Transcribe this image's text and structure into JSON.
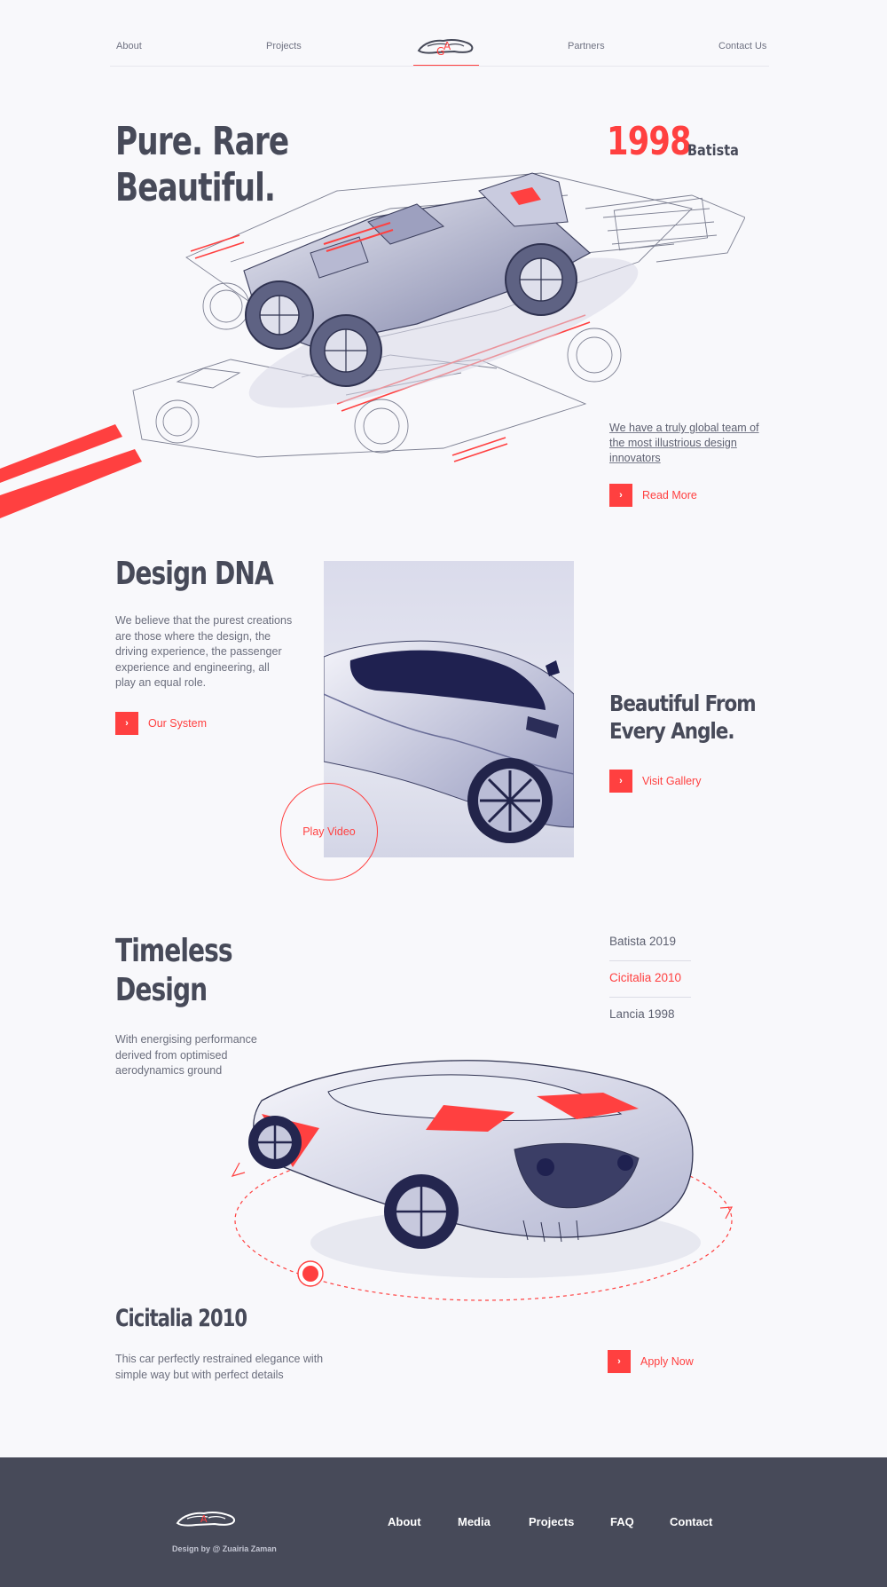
{
  "nav": {
    "about": "About",
    "projects": "Projects",
    "partners": "Partners",
    "contact": "Contact Us"
  },
  "hero": {
    "title_line1": "Pure. Rare",
    "title_line2": "Beautiful.",
    "year": "1998",
    "year_name": "Batista",
    "team_text": "We have a truly global team of the most illustrious design innovators",
    "read_more": "Read More"
  },
  "design_dna": {
    "title": "Design DNA",
    "body": "We believe that the purest creations are those where the design, the driving experience, the passenger experience and engineering, all play an equal role.",
    "cta": "Our System",
    "play_video": "Play Video",
    "angle_line1": "Beautiful From",
    "angle_line2": "Every Angle.",
    "gallery_cta": "Visit Gallery"
  },
  "timeless": {
    "title_line1": "Timeless",
    "title_line2": "Design",
    "body": "With energising performance derived from optimised aerodynamics ground",
    "models": [
      "Batista 2019",
      "Cicitalia 2010",
      "Lancia  1998"
    ],
    "active_model": 1,
    "car_name": "Cicitalia 2010",
    "car_desc": "This car perfectly restrained elegance with simple way but with perfect details",
    "apply_cta": "Apply Now"
  },
  "footer": {
    "links": [
      "About",
      "Media",
      "Projects",
      "FAQ",
      "Contact"
    ],
    "credit": "Design by @ Zuairia Zaman"
  },
  "colors": {
    "accent": "#ff4040",
    "ink": "#474a59",
    "background": "#f8f8fb",
    "footer": "#474a59"
  },
  "icons": {
    "logo": "car-logo-icon",
    "cta_arrow": "chevron-right-icon"
  }
}
